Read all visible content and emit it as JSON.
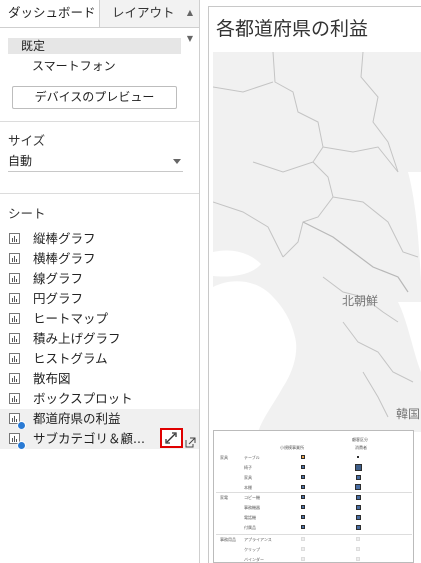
{
  "tabs": {
    "dashboard": "ダッシュボード",
    "layout": "レイアウト"
  },
  "device": {
    "default": "既定",
    "phone": "スマートフォン",
    "preview_button": "デバイスのプレビュー"
  },
  "size": {
    "heading": "サイズ",
    "value": "自動"
  },
  "sheets": {
    "heading": "シート",
    "items": [
      {
        "label": "縦棒グラフ"
      },
      {
        "label": "横棒グラフ"
      },
      {
        "label": "線グラフ"
      },
      {
        "label": "円グラフ"
      },
      {
        "label": "ヒートマップ"
      },
      {
        "label": "積み上げグラフ"
      },
      {
        "label": "ヒストグラム"
      },
      {
        "label": "散布図"
      },
      {
        "label": "ボックスプロット"
      },
      {
        "label": "都道府県の利益"
      },
      {
        "label": "サブカテゴリ＆顧..."
      }
    ]
  },
  "dashboard": {
    "title": "各都道府県の利益"
  },
  "map": {
    "labels": {
      "north_korea": "北朝鮮",
      "korea": "韓国"
    }
  },
  "table": {
    "col1": "小規模事業所",
    "col2_line1": "顧客区分",
    "col2_line2": "消費者",
    "groups": [
      {
        "name": "家具",
        "rows": [
          "テーブル",
          "椅子",
          "家具",
          "本棚"
        ]
      },
      {
        "name": "家電",
        "rows": [
          "コピー機",
          "事務機器",
          "電話機",
          "付属品"
        ]
      },
      {
        "name": "事務用品",
        "rows": [
          "アプライアンス",
          "クリップ",
          "バインダー"
        ]
      }
    ]
  },
  "colors": {
    "accent_red": "#e00000",
    "used_badge": "#2b7bd4",
    "map_land": "#f1f1f1"
  }
}
